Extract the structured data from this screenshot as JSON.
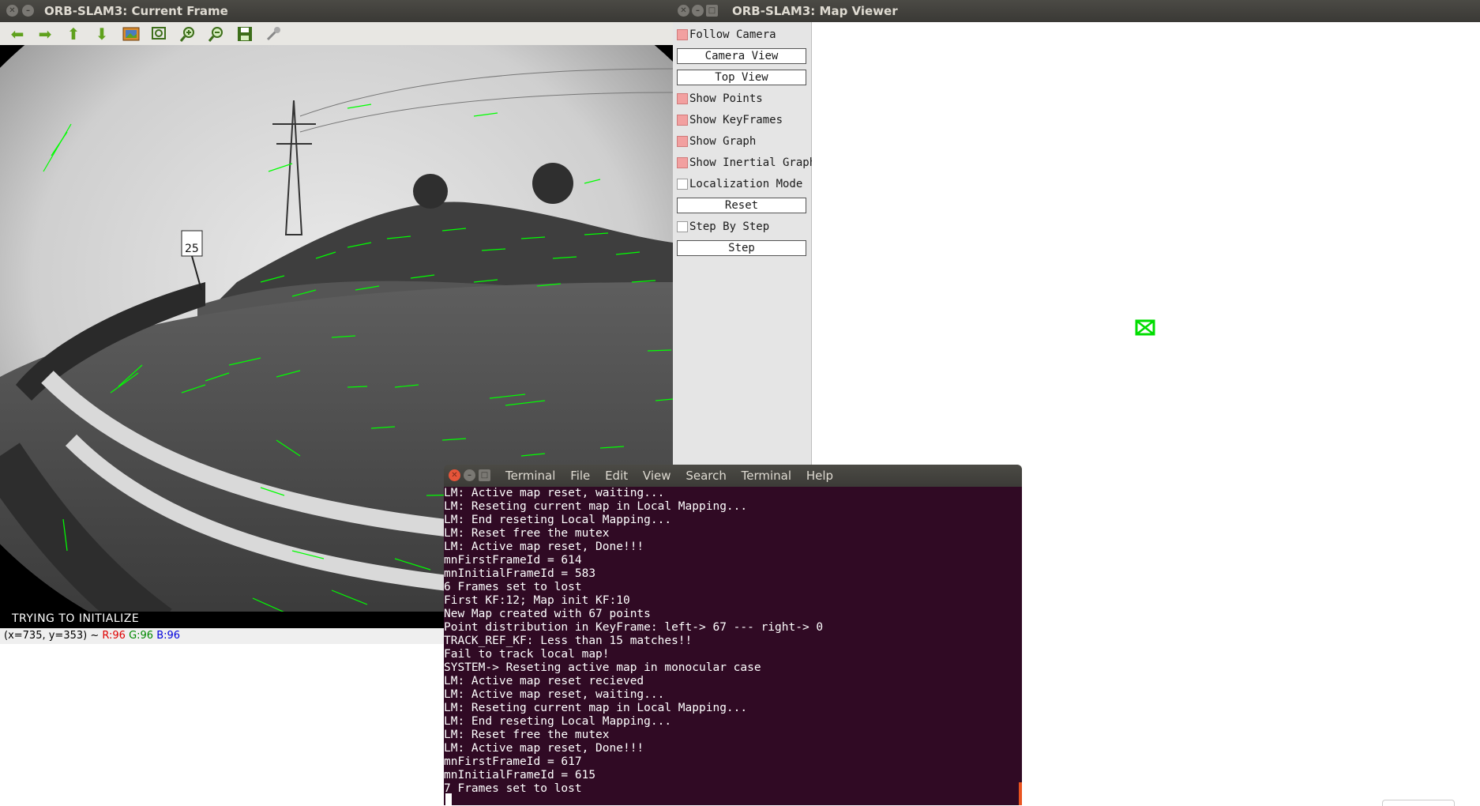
{
  "current_frame": {
    "title": "ORB-SLAM3: Current Frame",
    "toolbar_icons": [
      "arrow-left-icon",
      "arrow-right-icon",
      "arrow-up-icon",
      "arrow-down-icon",
      "image-icon",
      "zoom-fit-icon",
      "zoom-in-icon",
      "zoom-out-icon",
      "save-icon",
      "properties-icon"
    ],
    "status_text": "TRYING TO INITIALIZE",
    "pixel_info": {
      "coords": "(x=735, y=353) ~",
      "r": "R:96",
      "g": "G:96",
      "b": "B:96"
    }
  },
  "map_viewer": {
    "title": "ORB-SLAM3: Map Viewer",
    "follow_camera": {
      "label": "Follow Camera",
      "checked": true
    },
    "camera_view_label": "Camera View",
    "top_view_label": "Top View",
    "show_points": {
      "label": "Show Points",
      "checked": true
    },
    "show_keyframes": {
      "label": "Show KeyFrames",
      "checked": true
    },
    "show_graph": {
      "label": "Show Graph",
      "checked": true
    },
    "show_inertial_graph": {
      "label": "Show Inertial Graph",
      "checked": true
    },
    "localization_mode": {
      "label": "Localization Mode",
      "checked": false
    },
    "reset_label": "Reset",
    "step_by_step": {
      "label": "Step By Step",
      "checked": false
    },
    "step_label": "Step"
  },
  "terminal": {
    "title": "Terminal",
    "menu": [
      "File",
      "Edit",
      "View",
      "Search",
      "Terminal",
      "Help"
    ],
    "lines": [
      "LM: Active map reset, waiting...",
      "LM: Reseting current map in Local Mapping...",
      "LM: End reseting Local Mapping...",
      "LM: Reset free the mutex",
      "LM: Active map reset, Done!!!",
      "mnFirstFrameId = 614",
      "mnInitialFrameId = 583",
      "6 Frames set to lost",
      "First KF:12; Map init KF:10",
      "New Map created with 67 points",
      "Point distribution in KeyFrame: left-> 67 --- right-> 0",
      "TRACK_REF_KF: Less than 15 matches!!",
      "Fail to track local map!",
      "SYSTEM-> Reseting active map in monocular case",
      "LM: Active map reset recieved",
      "LM: Active map reset, waiting...",
      "LM: Reseting current map in Local Mapping...",
      "LM: End reseting Local Mapping...",
      "LM: Reset free the mutex",
      "LM: Active map reset, Done!!!",
      "mnFirstFrameId = 617",
      "mnInitialFrameId = 615",
      "7 Frames set to lost"
    ]
  },
  "colors": {
    "terminal_bg": "#300a24",
    "feature_green": "#00ff00",
    "checkbox_on": "#f2a0a0",
    "pixel_r": "#e00000",
    "pixel_g": "#008800",
    "pixel_b": "#0000dd"
  }
}
